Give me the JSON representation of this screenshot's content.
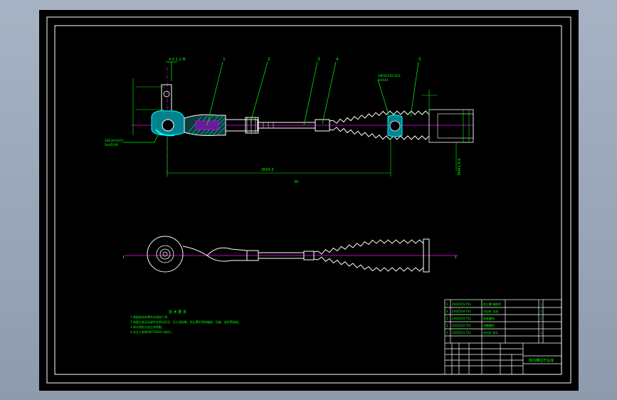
{
  "drawing": {
    "colors": {
      "background": "#000000",
      "frame": "#ffffff",
      "dimension": "#00ff00",
      "leader": "#00ff00",
      "center_line": "#ff00ff",
      "part_outline": "#ffffff",
      "hatch": "#00ffff",
      "section_fill": "#00bcd4",
      "title_block_text": "#00ff00",
      "surround": "#9aa6b8"
    },
    "balloons": [
      "1",
      "2",
      "3",
      "4",
      "5"
    ],
    "annotations": {
      "top_left_label": "4-5 1.2 M",
      "boot_callout": "SW56140.003\nSA4A1",
      "ball_joint_callout": "S6E3A1003\nSe4D1M",
      "overall_length": "3654 Z",
      "bottom_ref": "30",
      "right_dim": "M441.5-0",
      "view_label_left": "I",
      "view_label_right": "I"
    },
    "notes": {
      "heading": "技 术 要 求",
      "lines": [
        "1.装配前所有零件应清洗干净。",
        "2.装配后各运动部件应转动灵活，无卡滞现象，防尘罩不得有破损、扭曲、变形等缺陷。",
        "3.球头销处应加注润滑脂。",
        "4.未注公差按GB/T1804-m执行。"
      ]
    },
    "title_block": {
      "parts_rows": [
        {
          "no": "5",
          "code": "ZX0Z505-T01",
          "name": "防尘罩 橡胶件",
          "qty": "1"
        },
        {
          "no": "4",
          "code": "ZX0Z504-T01",
          "name": "内拉杆 总成",
          "qty": "1"
        },
        {
          "no": "3",
          "code": "ZX0Z503-T01",
          "name": "锁紧螺母",
          "qty": "1"
        },
        {
          "no": "2",
          "code": "ZX0Z502-T01",
          "name": "调整螺杆",
          "qty": "1"
        },
        {
          "no": "1",
          "code": "ZX0Z501-T01",
          "name": "外拉杆 球头",
          "qty": "1"
        }
      ],
      "drawing_title": "转向横拉杆总成"
    }
  }
}
